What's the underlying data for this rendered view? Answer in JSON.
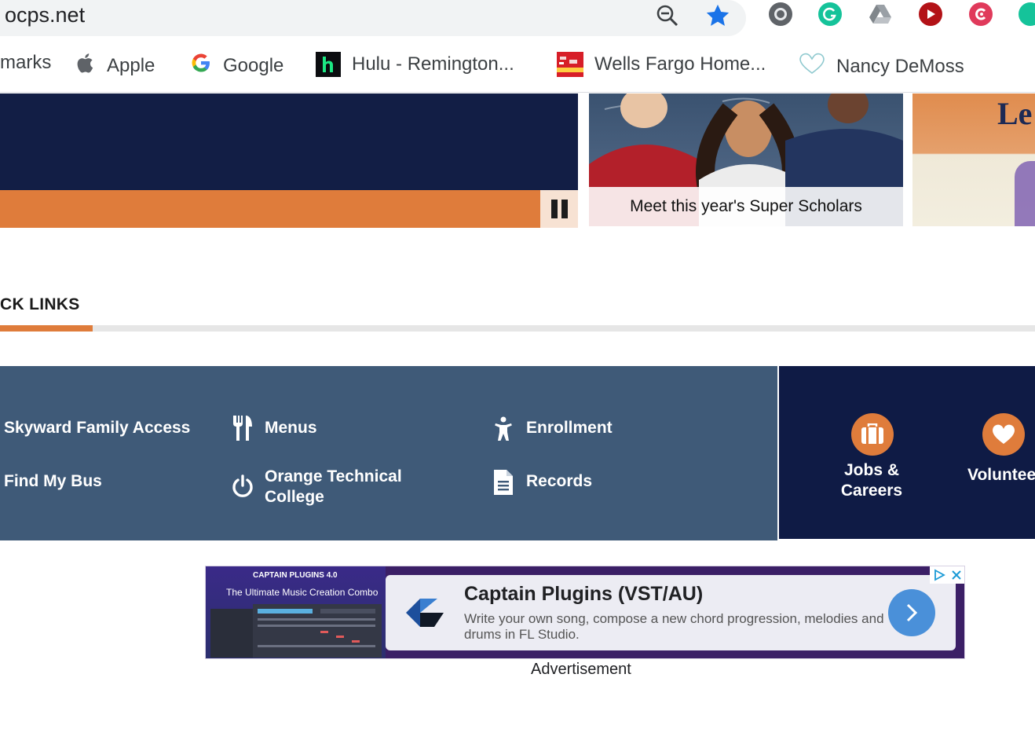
{
  "browser": {
    "address": "ocps.net",
    "bookmarks": [
      {
        "label": "marks",
        "icon": "bookmarks-icon"
      },
      {
        "label": "Apple",
        "icon": "apple-icon"
      },
      {
        "label": "Google",
        "icon": "google-icon"
      },
      {
        "label": "Hulu - Remington...",
        "icon": "hulu-icon"
      },
      {
        "label": "Wells Fargo Home...",
        "icon": "wells-fargo-icon"
      },
      {
        "label": "Nancy DeMoss",
        "icon": "heart-outline-icon"
      }
    ],
    "colors": {
      "star": "#1a73e8",
      "grammarly": "#15c39a",
      "youtube": "#b31217",
      "pocket": "#e03a5b"
    }
  },
  "hero": {
    "card1_caption": "Meet this year's Super Scholars",
    "card2_partial_text": "Le"
  },
  "quick_links": {
    "title": "CK LINKS",
    "items": [
      {
        "label": "Skyward Family Access"
      },
      {
        "label": "Find My Bus"
      },
      {
        "label": "Menus",
        "icon": "utensils-icon"
      },
      {
        "label": "Orange Technical College",
        "icon": "power-icon"
      },
      {
        "label": "Enrollment",
        "icon": "person-icon"
      },
      {
        "label": "Records",
        "icon": "document-icon"
      }
    ],
    "featured": [
      {
        "label": "Jobs & Careers",
        "icon": "briefcase-icon"
      },
      {
        "label": "Voluntee",
        "icon": "heart-icon"
      }
    ]
  },
  "ad": {
    "brand": "CAPTAIN PLUGINS 4.0",
    "tagline": "The Ultimate Music Creation Combo",
    "title": "Captain Plugins (VST/AU)",
    "description": "Write your own song, compose a new chord progression, melodies and drums in FL Studio.",
    "caption": "Advertisement"
  },
  "colors": {
    "navy": "#121e45",
    "orange": "#df7c3b",
    "slate": "#3f5a78"
  }
}
